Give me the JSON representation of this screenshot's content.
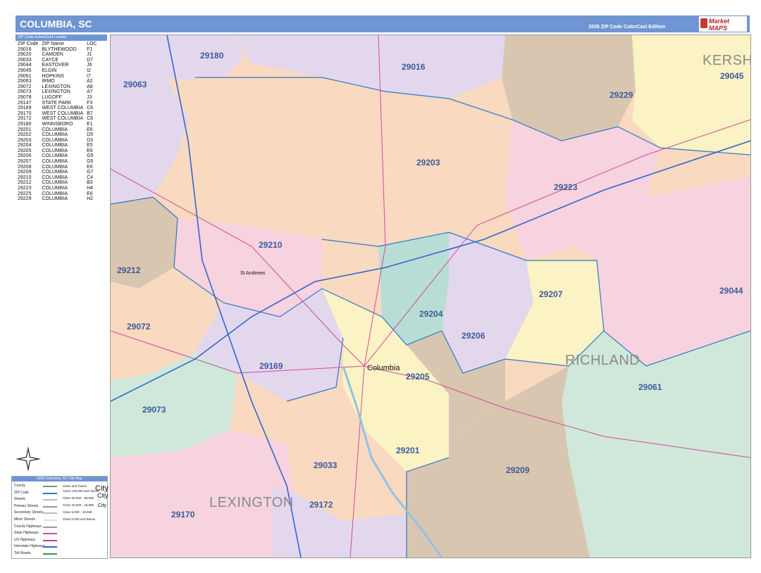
{
  "header": {
    "title": "COLUMBIA, SC",
    "edition": "2026 ZIP Code ColorCast Edition",
    "logo_text": "Market MAPS"
  },
  "index": {
    "heading": "ZIP Code Index/Grid Locator",
    "columns": [
      "ZIP Code",
      "ZIP Name",
      "LOC"
    ],
    "rows": [
      [
        "29016",
        "BLYTHEWOOD",
        "F1"
      ],
      [
        "29020",
        "CAMDEN",
        "J1"
      ],
      [
        "29033",
        "CAYCE",
        "D7"
      ],
      [
        "29044",
        "EASTOVER",
        "J6"
      ],
      [
        "29045",
        "ELGIN",
        "I2"
      ],
      [
        "29061",
        "HOPKINS",
        "I7"
      ],
      [
        "29063",
        "IRMO",
        "A2"
      ],
      [
        "29072",
        "LEXINGTON",
        "A8"
      ],
      [
        "29073",
        "LEXINGTON",
        "A7"
      ],
      [
        "29078",
        "LUGOFF",
        "J3"
      ],
      [
        "29147",
        "STATE PARK",
        "F3"
      ],
      [
        "29169",
        "WEST COLUMBIA",
        "C6"
      ],
      [
        "29170",
        "WEST COLUMBIA",
        "B7"
      ],
      [
        "29172",
        "WEST COLUMBIA",
        "C8"
      ],
      [
        "29180",
        "WINNSBORO",
        "E1"
      ],
      [
        "29201",
        "COLUMBIA",
        "E6"
      ],
      [
        "29202",
        "COLUMBIA",
        "D5"
      ],
      [
        "29203",
        "COLUMBIA",
        "D3"
      ],
      [
        "29204",
        "COLUMBIA",
        "E5"
      ],
      [
        "29205",
        "COLUMBIA",
        "E6"
      ],
      [
        "29206",
        "COLUMBIA",
        "G5"
      ],
      [
        "29207",
        "COLUMBIA",
        "G5"
      ],
      [
        "29208",
        "COLUMBIA",
        "E6"
      ],
      [
        "29209",
        "COLUMBIA",
        "G7"
      ],
      [
        "29210",
        "COLUMBIA",
        "C4"
      ],
      [
        "29212",
        "COLUMBIA",
        "B3"
      ],
      [
        "29223",
        "COLUMBIA",
        "H4"
      ],
      [
        "29225",
        "COLUMBIA",
        "E6"
      ],
      [
        "29229",
        "COLUMBIA",
        "H2"
      ]
    ]
  },
  "map": {
    "zip_labels": [
      {
        "text": "29180"
      },
      {
        "text": "29016"
      },
      {
        "text": "29063"
      },
      {
        "text": "29229"
      },
      {
        "text": "29045"
      },
      {
        "text": "29203"
      },
      {
        "text": "29223"
      },
      {
        "text": "29210"
      },
      {
        "text": "29212"
      },
      {
        "text": "29207"
      },
      {
        "text": "29044"
      },
      {
        "text": "29204"
      },
      {
        "text": "29072"
      },
      {
        "text": "29206"
      },
      {
        "text": "29169"
      },
      {
        "text": "29205"
      },
      {
        "text": "29061"
      },
      {
        "text": "29073"
      },
      {
        "text": "29201"
      },
      {
        "text": "29033"
      },
      {
        "text": "29209"
      },
      {
        "text": "29172"
      },
      {
        "text": "29170"
      }
    ],
    "county_labels": [
      "KERSHAW",
      "RICHLAND",
      "LEXINGTON"
    ],
    "city_label": "Columbia",
    "place_label": "St Andrews",
    "colors": {
      "peach": "#f9d9c0",
      "lavender": "#e3d7ee",
      "tan": "#d9c6b0",
      "pink": "#f6d3de",
      "yellow": "#fbf3c4",
      "green": "#cfe8da",
      "teal": "#b8ddd4",
      "blue_outline": "#2f78c4"
    }
  },
  "legend": {
    "heading": "2026 Columbia, SC City Map",
    "rows": [
      "County",
      "ZIP Code",
      "Streets",
      "Primary Streets",
      "Secondary Streets",
      "Minor Streets",
      "County Highways",
      "State Highways",
      "US Highways",
      "Interstate Highways",
      "Toll Roads"
    ],
    "cities_heading": "Cities and Towns",
    "cities": [
      "Cities 100,000 and Above",
      "Cities 50,000 - 99,999",
      "Cities 20,000 - 49,999",
      "Cities 5,000 - 19,999",
      "Cities 0,000 and Below"
    ],
    "city_big": "City",
    "city_mid": "City",
    "city_small": "-City"
  }
}
